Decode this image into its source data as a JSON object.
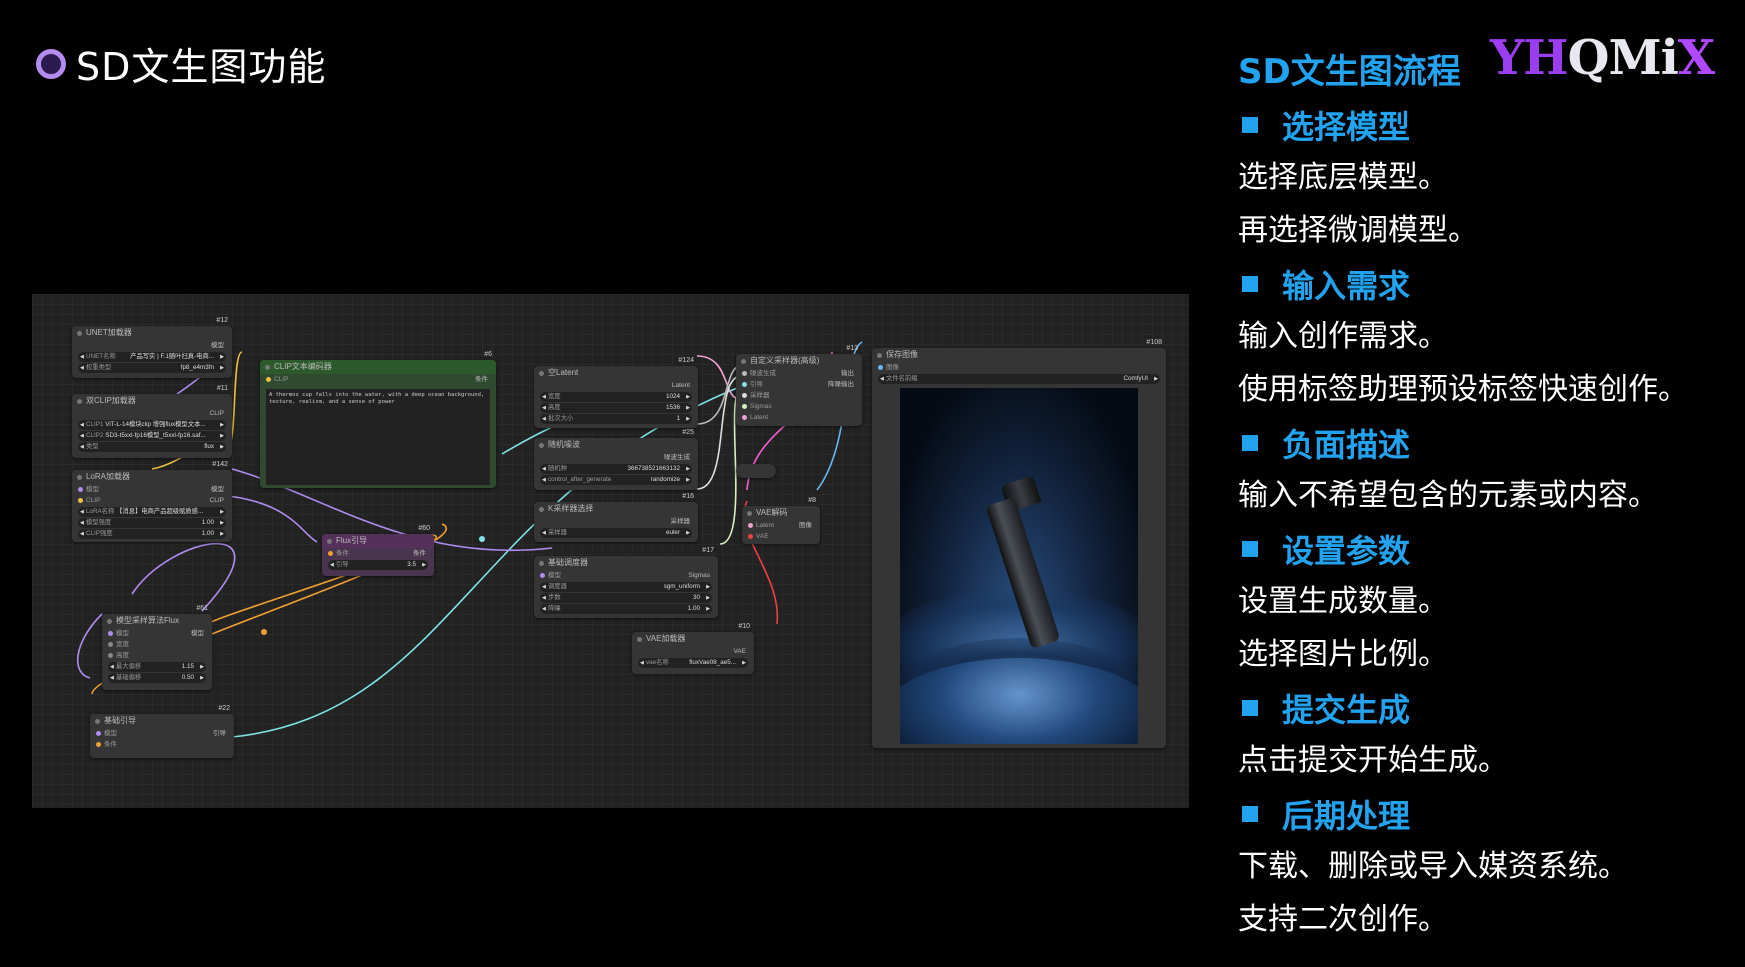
{
  "slide": {
    "title": "SD文生图功能",
    "logo": {
      "part1": "YH",
      "part2": "QMi",
      "part3": "X"
    }
  },
  "workflow_panel": {
    "title": "SD文生图流程",
    "sections": [
      {
        "heading": "选择模型",
        "lines": [
          "选择底层模型。",
          "再选择微调模型。"
        ]
      },
      {
        "heading": "输入需求",
        "lines": [
          "输入创作需求。",
          "使用标签助理预设标签快速创作。"
        ]
      },
      {
        "heading": "负面描述",
        "lines": [
          "输入不希望包含的元素或内容。"
        ]
      },
      {
        "heading": "设置参数",
        "lines": [
          "设置生成数量。",
          "选择图片比例。"
        ]
      },
      {
        "heading": "提交生成",
        "lines": [
          "点击提交开始生成。"
        ]
      },
      {
        "heading": "后期处理",
        "lines": [
          "下载、删除或导入媒资系统。",
          "支持二次创作。"
        ]
      }
    ]
  },
  "comfy": {
    "unet": {
      "id": "#12",
      "title": "UNET加载器",
      "out": "模型",
      "w1_label": "UNET名称",
      "w1_value": "产品写实 | F.1随叶扫真-电商...",
      "w2_label": "权重类型",
      "w2_value": "fp8_e4m3fn"
    },
    "dualclip": {
      "id": "#11",
      "title": "双CLIP加载器",
      "out": "CLIP",
      "w1_label": "CLIP1",
      "w1_value": "ViT-L-14模块clip 增强flux模型文本...",
      "w2_label": "CLIP2",
      "w2_value": "SD3-t5xxl-fp16模型_t5xxl-fp16.saf...",
      "w3_label": "类型",
      "w3_value": "flux"
    },
    "lora": {
      "id": "#142",
      "title": "LoRA加载器",
      "in1": "模型",
      "in2": "CLIP",
      "out1": "模型",
      "out2": "CLIP",
      "w1_label": "LoRA名称",
      "w1_value": "【消息】电商产品超级赋质感...",
      "w2_label": "模型强度",
      "w2_value": "1.00",
      "w3_label": "CLIP强度",
      "w3_value": "1.00"
    },
    "clip_text": {
      "id": "#6",
      "title": "CLIP文本编码器",
      "in": "CLIP",
      "out": "条件",
      "text": "A thermos cup falls into the water, with a deep ocean background, texture, realism, and a sense of power"
    },
    "flux_guide": {
      "id": "#60",
      "title": "Flux引导",
      "in": "条件",
      "out": "条件",
      "w_label": "引导",
      "w_value": "3.5"
    },
    "model_sampling": {
      "id": "#61",
      "title": "模型采样算法Flux",
      "in1": "模型",
      "in2": "宽度",
      "in3": "高度",
      "out": "模型",
      "w1_label": "最大偏移",
      "w1_value": "1.15",
      "w2_label": "基础偏移",
      "w2_value": "0.50"
    },
    "basic_guider": {
      "id": "#22",
      "title": "基础引导",
      "in1": "模型",
      "in2": "条件",
      "out": "引导"
    },
    "empty_latent": {
      "id": "#124",
      "title": "空Latent",
      "out": "Latent",
      "w1_label": "宽度",
      "w1_value": "1024",
      "w2_label": "高度",
      "w2_value": "1536",
      "w3_label": "批次大小",
      "w3_value": "1"
    },
    "noise": {
      "id": "#25",
      "title": "随机噪波",
      "out": "噪波生成",
      "w1_label": "随机种",
      "w1_value": "366738521663132",
      "w2_label": "control_after_generate",
      "w2_value": "randomize"
    },
    "ksampler_select": {
      "id": "#16",
      "title": "K采样器选择",
      "out": "采样器",
      "w_label": "采样器",
      "w_value": "euler"
    },
    "basic_scheduler": {
      "id": "#17",
      "title": "基础调度器",
      "in": "模型",
      "out": "Sigmas",
      "w1_label": "调度器",
      "w1_value": "sgm_uniform",
      "w2_label": "步数",
      "w2_value": "30",
      "w3_label": "降噪",
      "w3_value": "1.00"
    },
    "custom_sampler": {
      "id": "#13",
      "title": "自定义采样器(高级)",
      "in1": "噪波生成",
      "in2": "引导",
      "in3": "采样器",
      "in4": "Sigmas",
      "in5": "Latent",
      "out1": "输出",
      "out2": "降噪输出"
    },
    "vae_decode": {
      "id": "#8",
      "title": "VAE解码",
      "in1": "Latent",
      "in2": "VAE",
      "out": "图像"
    },
    "vae_loader": {
      "id": "#10",
      "title": "VAE加载器",
      "out": "VAE",
      "w_label": "vae名称",
      "w_value": "fluxVae08_ae5..."
    },
    "save_image": {
      "id": "#108",
      "title": "保存图像",
      "in": "图像",
      "w_label": "文件名前缀",
      "w_value": "ComfyUI"
    }
  },
  "colors": {
    "accent_blue": "#21a3f0",
    "purple": "#b48cf0",
    "link_cyan": "#7fe3e8",
    "link_orange": "#f0a030",
    "link_purple": "#b08cf0"
  }
}
